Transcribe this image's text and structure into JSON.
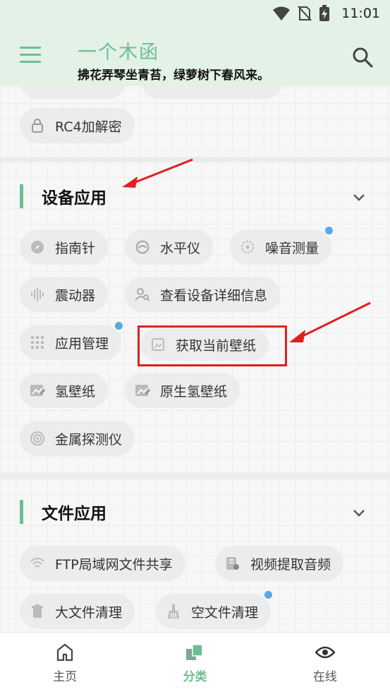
{
  "status_bar": {
    "time": "11:01"
  },
  "header": {
    "title": "一个木函",
    "subtitle": "拂花弄琴坐青苔，绿萝树下春风来。"
  },
  "top_section": {
    "items": [
      {
        "label": "RC4加解密",
        "icon": "lock-icon"
      }
    ]
  },
  "device_section": {
    "title": "设备应用",
    "items": [
      {
        "label": "指南针",
        "icon": "compass-icon",
        "new": false
      },
      {
        "label": "水平仪",
        "icon": "level-icon",
        "new": false
      },
      {
        "label": "噪音测量",
        "icon": "noise-icon",
        "new": true
      },
      {
        "label": "震动器",
        "icon": "vibrate-icon",
        "new": false
      },
      {
        "label": "查看设备详细信息",
        "icon": "device-info-icon",
        "new": false
      },
      {
        "label": "应用管理",
        "icon": "apps-grid-icon",
        "new": true
      },
      {
        "label": "获取当前壁纸",
        "icon": "wallpaper-icon",
        "new": false
      },
      {
        "label": "氢壁纸",
        "icon": "hydrogen-wallpaper-icon",
        "new": false
      },
      {
        "label": "原生氢壁纸",
        "icon": "native-wallpaper-icon",
        "new": false
      },
      {
        "label": "金属探测仪",
        "icon": "metal-detector-icon",
        "new": false
      }
    ]
  },
  "file_section": {
    "title": "文件应用",
    "items": [
      {
        "label": "FTP局域网文件共享",
        "icon": "wifi-icon",
        "new": false
      },
      {
        "label": "视频提取音频",
        "icon": "video-audio-icon",
        "new": false
      },
      {
        "label": "大文件清理",
        "icon": "trash-icon",
        "new": false
      },
      {
        "label": "空文件清理",
        "icon": "broom-icon",
        "new": true
      }
    ]
  },
  "bottom_nav": {
    "items": [
      {
        "label": "主页",
        "active": false
      },
      {
        "label": "分类",
        "active": true
      },
      {
        "label": "在线",
        "active": false
      }
    ]
  },
  "colors": {
    "accent": "#6cbf92",
    "badge": "#5aa9e6",
    "annotation": "#e02020"
  }
}
